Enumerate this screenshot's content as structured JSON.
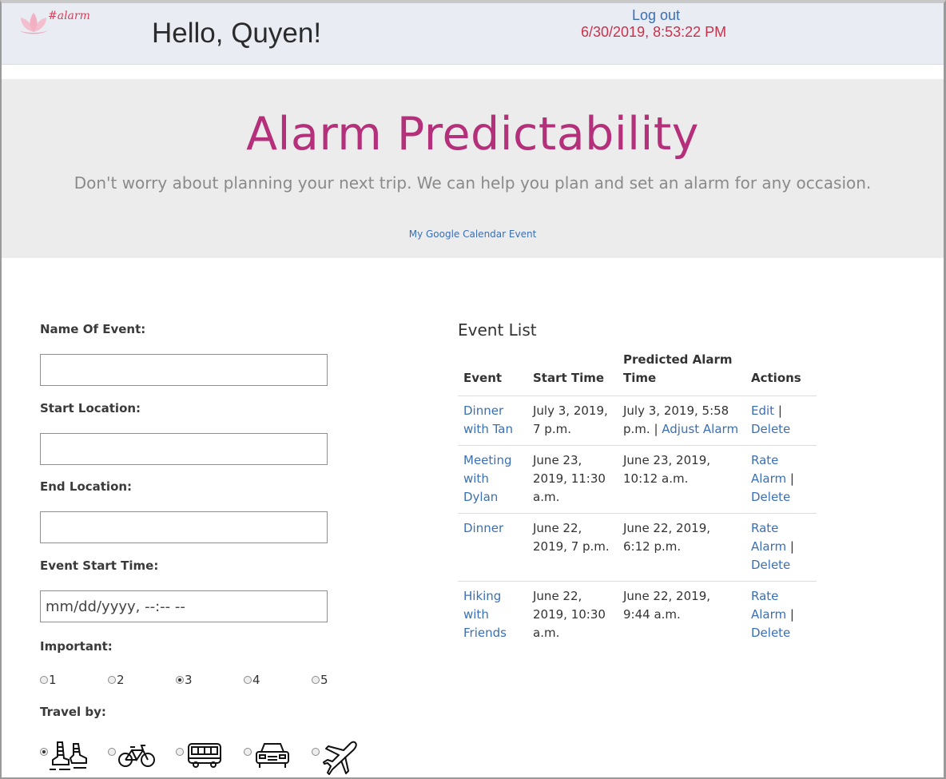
{
  "header": {
    "logo_text": "#alarm",
    "greeting": "Hello, Quyen!",
    "logout_label": "Log out",
    "datetime": "6/30/2019, 8:53:22 PM"
  },
  "hero": {
    "title": "Alarm Predictability",
    "subtitle": "Don't worry about planning your next trip. We can help you plan and set an alarm for any occasion.",
    "calendar_link": "My Google Calendar Event"
  },
  "form": {
    "name_label": "Name Of Event:",
    "start_location_label": "Start Location:",
    "end_location_label": "End Location:",
    "start_time_label": "Event Start Time:",
    "start_time_placeholder": "mm/dd/yyyy, --:-- --",
    "important_label": "Important:",
    "importance_options": [
      "1",
      "2",
      "3",
      "4",
      "5"
    ],
    "importance_selected": "3",
    "travel_label": "Travel by:",
    "travel_options": [
      "walk-icon",
      "bicycle-icon",
      "bus-icon",
      "car-icon",
      "airplane-icon"
    ],
    "travel_selected": "walk-icon"
  },
  "event_list": {
    "title": "Event List",
    "headers": [
      "Event",
      "Start Time",
      "Predicted Alarm Time",
      "Actions"
    ],
    "rows": [
      {
        "event": "Dinner with Tan",
        "start": "July 3, 2019, 7 p.m.",
        "alarm": "July 3, 2019, 5:58 p.m.",
        "alarm_action": "Adjust Alarm",
        "action1": "Edit",
        "action2": "Delete"
      },
      {
        "event": "Meeting with Dylan",
        "start": "June 23, 2019, 11:30 a.m.",
        "alarm": "June 23, 2019, 10:12 a.m.",
        "alarm_action": "",
        "action1": "Rate Alarm",
        "action2": "Delete"
      },
      {
        "event": "Dinner",
        "start": "June 22, 2019, 7 p.m.",
        "alarm": "June 22, 2019, 6:12 p.m.",
        "alarm_action": "",
        "action1": "Rate Alarm",
        "action2": "Delete"
      },
      {
        "event": "Hiking with Friends",
        "start": "June 22, 2019, 10:30 a.m.",
        "alarm": "June 22, 2019, 9:44 a.m.",
        "alarm_action": "",
        "action1": "Rate Alarm",
        "action2": "Delete"
      }
    ]
  },
  "colors": {
    "accent": "#b5307a",
    "link": "#3a6fb5",
    "clock": "#c8334b",
    "header_bg": "#e9ecf3",
    "hero_bg": "#ececec"
  }
}
